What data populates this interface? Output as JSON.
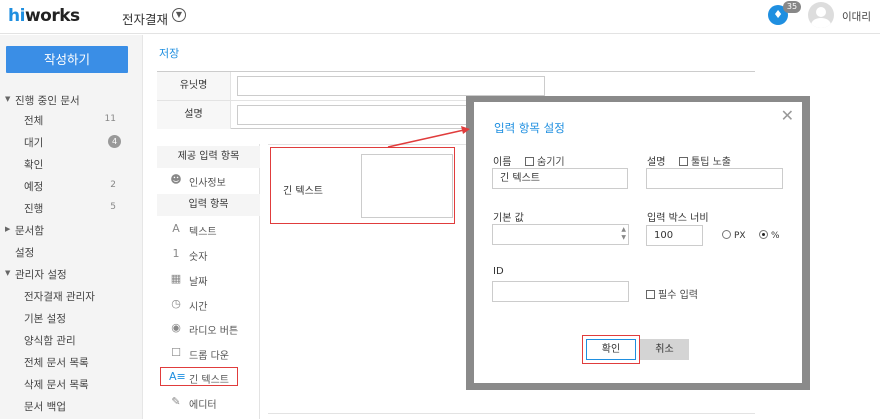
{
  "header": {
    "logo_prefix": "hi",
    "logo_rest": "works",
    "app_title": "전자결재",
    "notification_count": "35",
    "user_name": "이대리"
  },
  "sidebar": {
    "compose_label": "작성하기",
    "items": [
      {
        "label": "진행 중인 문서",
        "count": ""
      },
      {
        "label": "전체",
        "count": "11"
      },
      {
        "label": "대기",
        "count": "4"
      },
      {
        "label": "확인",
        "count": ""
      },
      {
        "label": "예정",
        "count": "2"
      },
      {
        "label": "진행",
        "count": "5"
      },
      {
        "label": "문서함",
        "count": ""
      },
      {
        "label": "설정",
        "count": ""
      },
      {
        "label": "관리자 설정",
        "count": ""
      },
      {
        "label": "전자결재 관리자",
        "count": ""
      },
      {
        "label": "기본 설정",
        "count": ""
      },
      {
        "label": "양식함 관리",
        "count": ""
      },
      {
        "label": "전체 문서 목록",
        "count": ""
      },
      {
        "label": "삭제 문서 목록",
        "count": ""
      },
      {
        "label": "문서 백업",
        "count": ""
      }
    ]
  },
  "main": {
    "save_label": "저장",
    "form_rows": [
      {
        "label": "유닛명",
        "value": ""
      },
      {
        "label": "설명",
        "value": ""
      }
    ],
    "palette": {
      "provided_header": "제공 입력 항목",
      "hr_item": "인사정보",
      "input_header": "입력 항목",
      "items": [
        {
          "icon": "text-icon",
          "glyph": "A",
          "label": "텍스트"
        },
        {
          "icon": "number-icon",
          "glyph": "1",
          "label": "숫자"
        },
        {
          "icon": "date-icon",
          "glyph": "▦",
          "label": "날짜"
        },
        {
          "icon": "clock-icon",
          "glyph": "◷",
          "label": "시간"
        },
        {
          "icon": "radio-icon",
          "glyph": "◉",
          "label": "라디오 버튼"
        },
        {
          "icon": "dropdown-icon",
          "glyph": "☐",
          "label": "드롭 다운"
        },
        {
          "icon": "longtext-icon",
          "glyph": "A≡",
          "label": "긴 텍스트"
        },
        {
          "icon": "editor-icon",
          "glyph": "✎",
          "label": "에디터"
        }
      ]
    },
    "canvas_field_label": "긴 텍스트"
  },
  "modal": {
    "title": "입력 항목 설정",
    "name_label": "이름",
    "hide_label": "숨기기",
    "name_value": "긴 텍스트",
    "desc_label": "설명",
    "tooltip_label": "툴팁 노출",
    "desc_value": "",
    "default_label": "기본 값",
    "default_value": "",
    "width_label": "입력 박스 너비",
    "width_value": "100",
    "unit_px": "PX",
    "unit_pct": "%",
    "unit_selected": "%",
    "id_label": "ID",
    "id_value": "",
    "required_label": "필수 입력",
    "ok_label": "확인",
    "cancel_label": "취소"
  },
  "colors": {
    "accent": "#1f8fe0",
    "highlight": "#e03c3c"
  }
}
